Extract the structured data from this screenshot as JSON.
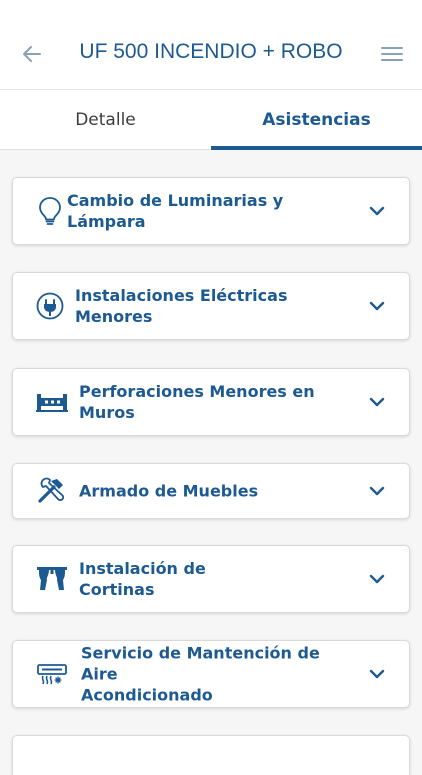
{
  "header": {
    "title": "UF 500 INCENDIO + ROBO",
    "back_icon": "arrow-left-icon",
    "menu_icon": "hamburger-menu-icon"
  },
  "tabs": [
    {
      "label": "Detalle",
      "active": false
    },
    {
      "label": "Asistencias",
      "active": true
    }
  ],
  "services": [
    {
      "line1": "Cambio de Luminarias y",
      "line2": "Lámpara",
      "icon": "lightbulb-icon"
    },
    {
      "line1": "Instalaciones Eléctricas",
      "line2": "Menores",
      "icon": "plug-icon"
    },
    {
      "line1": "Perforaciones Menores en",
      "line2": "Muros",
      "icon": "drill-icon"
    },
    {
      "line1": "Armado de Muebles",
      "line2": "",
      "icon": "tools-icon"
    },
    {
      "line1": "Instalación de",
      "line2": "Cortinas",
      "icon": "curtains-icon"
    },
    {
      "line1": "Servicio de Mantención de Aire",
      "line2": "Acondicionado",
      "icon": "air-conditioner-icon"
    }
  ],
  "colors": {
    "primary": "#1d5a92",
    "background": "#f6f6f6",
    "card": "#ffffff",
    "inactive_tab": "#3c3c3c"
  }
}
